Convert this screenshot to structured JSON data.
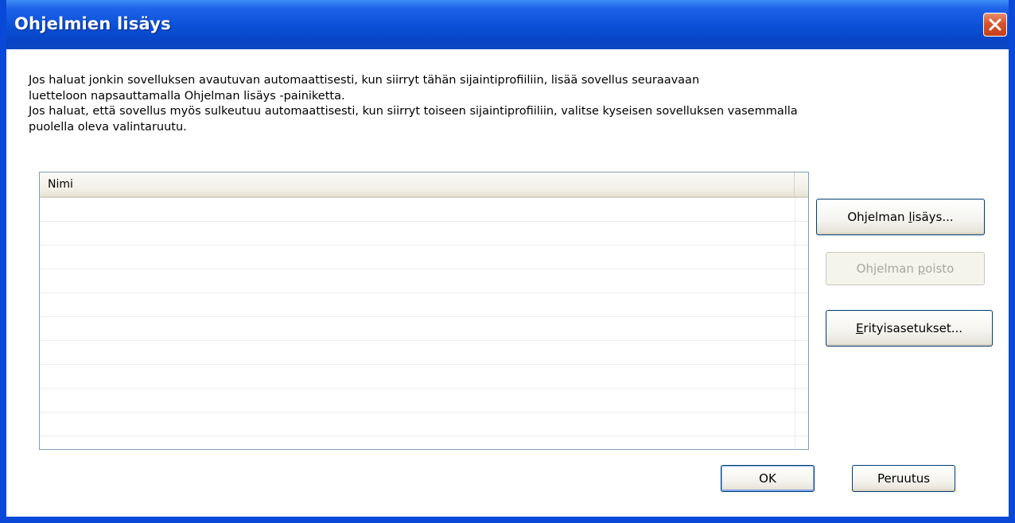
{
  "window": {
    "title": "Ohjelmien lisäys",
    "close_icon": "close-icon"
  },
  "description": {
    "line1": "Jos haluat jonkin sovelluksen avautuvan automaattisesti, kun siirryt tähän sijaintiprofiiliin, lisää sovellus seuraavaan",
    "line2": "luetteloon napsauttamalla Ohjelman lisäys -painiketta.",
    "line3": "Jos haluat, että sovellus myös sulkeutuu automaattisesti, kun siirryt toiseen sijaintiprofiiliin, valitse kyseisen sovelluksen vasemmalla",
    "line4": "puolella oleva valintaruutu."
  },
  "list": {
    "column_name": "Nimi",
    "rows": []
  },
  "buttons": {
    "add_pre": "Ohjelman ",
    "add_key": "l",
    "add_post": "isäys...",
    "remove_pre": "Ohjelman ",
    "remove_key": "p",
    "remove_post": "oisto",
    "remove_enabled": false,
    "advanced_key": "E",
    "advanced_post": "rityisasetukset...",
    "ok": "OK",
    "cancel": "Peruutus"
  },
  "colors": {
    "titlebar": "#0a4fd6",
    "close_button": "#d8542b",
    "client_background": "#ffffff"
  }
}
